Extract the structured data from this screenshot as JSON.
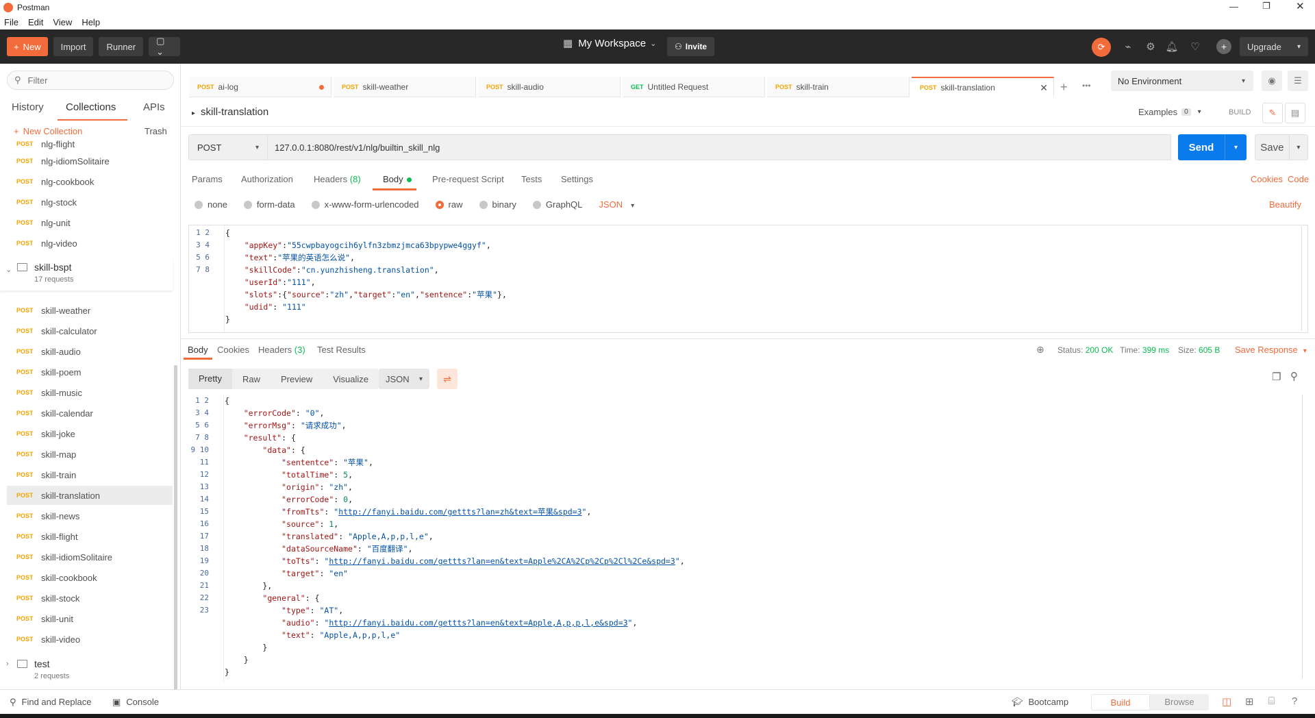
{
  "app": {
    "title": "Postman",
    "menu": [
      "File",
      "Edit",
      "View",
      "Help"
    ]
  },
  "header": {
    "new": "New",
    "import": "Import",
    "runner": "Runner",
    "workspace": "My Workspace",
    "invite": "Invite",
    "upgrade": "Upgrade"
  },
  "sidebar": {
    "filter_placeholder": "Filter",
    "tabs": [
      "History",
      "Collections",
      "APIs"
    ],
    "new_collection": "New Collection",
    "trash": "Trash",
    "top_items": [
      {
        "m": "POST",
        "n": "nlg-flight"
      },
      {
        "m": "POST",
        "n": "nlg-idiomSolitaire"
      },
      {
        "m": "POST",
        "n": "nlg-cookbook"
      },
      {
        "m": "POST",
        "n": "nlg-stock"
      },
      {
        "m": "POST",
        "n": "nlg-unit"
      },
      {
        "m": "POST",
        "n": "nlg-video"
      }
    ],
    "folder1": {
      "name": "skill-bspt",
      "count": "17 requests"
    },
    "items": [
      {
        "m": "POST",
        "n": "skill-weather"
      },
      {
        "m": "POST",
        "n": "skill-calculator"
      },
      {
        "m": "POST",
        "n": "skill-audio"
      },
      {
        "m": "POST",
        "n": "skill-poem"
      },
      {
        "m": "POST",
        "n": "skill-music"
      },
      {
        "m": "POST",
        "n": "skill-calendar"
      },
      {
        "m": "POST",
        "n": "skill-joke"
      },
      {
        "m": "POST",
        "n": "skill-map"
      },
      {
        "m": "POST",
        "n": "skill-train"
      },
      {
        "m": "POST",
        "n": "skill-translation"
      },
      {
        "m": "POST",
        "n": "skill-news"
      },
      {
        "m": "POST",
        "n": "skill-flight"
      },
      {
        "m": "POST",
        "n": "skill-idiomSolitaire"
      },
      {
        "m": "POST",
        "n": "skill-cookbook"
      },
      {
        "m": "POST",
        "n": "skill-stock"
      },
      {
        "m": "POST",
        "n": "skill-unit"
      },
      {
        "m": "POST",
        "n": "skill-video"
      }
    ],
    "folder2": {
      "name": "test",
      "count": "2 requests"
    }
  },
  "tabs": [
    {
      "m": "POST",
      "n": "ai-log"
    },
    {
      "m": "POST",
      "n": "skill-weather"
    },
    {
      "m": "POST",
      "n": "skill-audio"
    },
    {
      "m": "GET",
      "n": "Untitled Request"
    },
    {
      "m": "POST",
      "n": "skill-train"
    },
    {
      "m": "POST",
      "n": "skill-translation"
    }
  ],
  "env": "No Environment",
  "request": {
    "name": "skill-translation",
    "examples": "Examples",
    "examples_count": "0",
    "build": "BUILD",
    "method": "POST",
    "url": "127.0.0.1:8080/rest/v1/nlg/builtin_skill_nlg",
    "send": "Send",
    "save": "Save",
    "subtabs": [
      "Params",
      "Authorization",
      "Headers",
      "(8)",
      "Body",
      "Pre-request Script",
      "Tests",
      "Settings"
    ],
    "cookies": "Cookies",
    "code": "Code",
    "body_types": [
      "none",
      "form-data",
      "x-www-form-urlencoded",
      "raw",
      "binary",
      "GraphQL"
    ],
    "format": "JSON",
    "beautify": "Beautify"
  },
  "response": {
    "tabs": [
      "Body",
      "Cookies",
      "Headers",
      "(3)",
      "Test Results"
    ],
    "status_label": "Status:",
    "status": "200 OK",
    "time_label": "Time:",
    "time": "399 ms",
    "size_label": "Size:",
    "size": "605 B",
    "save": "Save Response",
    "views": [
      "Pretty",
      "Raw",
      "Preview",
      "Visualize"
    ],
    "format": "JSON"
  },
  "footer": {
    "find": "Find and Replace",
    "console": "Console",
    "bootcamp": "Bootcamp",
    "build": "Build",
    "browse": "Browse"
  },
  "colors": {
    "accent": "#f26b3a",
    "send": "#097bed",
    "post": "#f4a300",
    "get": "#0cbb52"
  }
}
